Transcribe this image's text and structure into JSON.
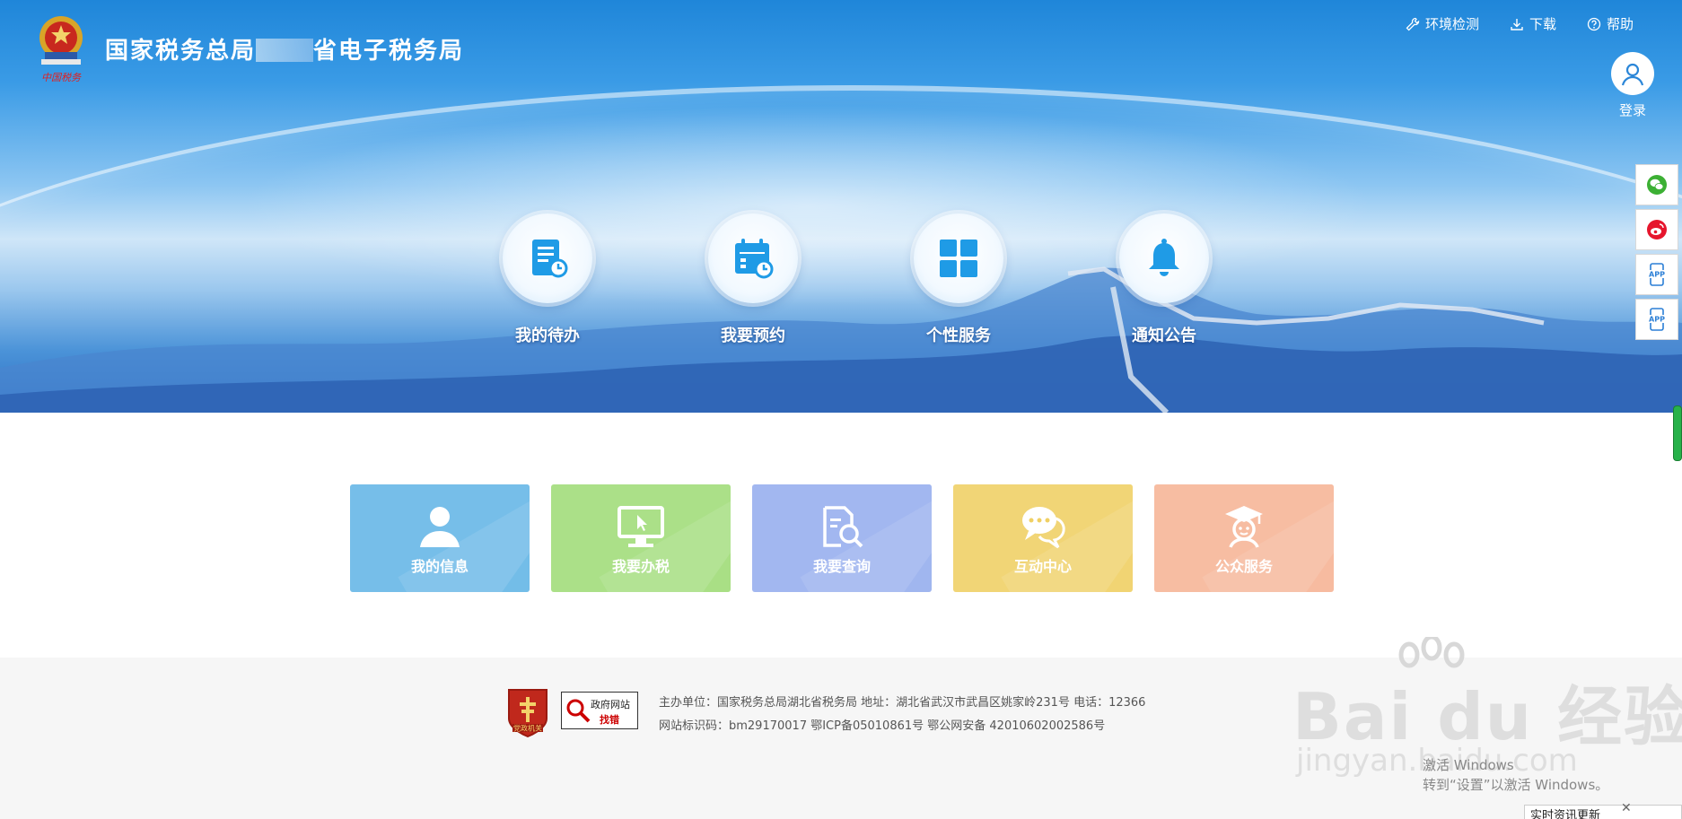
{
  "header": {
    "title_prefix": "国家税务总局",
    "title_suffix": "省电子税务局",
    "logo_caption": "中国税务",
    "links": [
      {
        "label": "环境检测",
        "icon": "wrench-icon"
      },
      {
        "label": "下载",
        "icon": "download-icon"
      },
      {
        "label": "帮助",
        "icon": "help-icon"
      }
    ],
    "login_label": "登录"
  },
  "hero_items": [
    {
      "label": "我的待办",
      "icon": "todo-document-icon"
    },
    {
      "label": "我要预约",
      "icon": "calendar-clock-icon"
    },
    {
      "label": "个性服务",
      "icon": "grid-icon"
    },
    {
      "label": "通知公告",
      "icon": "bell-icon"
    }
  ],
  "side_toolbar": [
    {
      "name": "wechat",
      "icon": "wechat-icon",
      "color": "#3cb034"
    },
    {
      "name": "weibo",
      "icon": "weibo-icon",
      "color": "#e6162d"
    },
    {
      "name": "app1",
      "icon": "app-phone-icon",
      "label": "APP",
      "color": "#2b7fd6"
    },
    {
      "name": "app2",
      "icon": "app-phone-icon",
      "label": "APP",
      "color": "#2b7fd6"
    }
  ],
  "tiles": [
    {
      "label": "我的信息",
      "icon": "user-icon",
      "color": "#64b6e6"
    },
    {
      "label": "我要办税",
      "icon": "monitor-cursor-icon",
      "color": "#a0dc78"
    },
    {
      "label": "我要查询",
      "icon": "document-search-icon",
      "color": "#96aeee"
    },
    {
      "label": "互动中心",
      "icon": "chat-bubbles-icon",
      "color": "#f0d064"
    },
    {
      "label": "公众服务",
      "icon": "graduate-icon",
      "color": "#f6b496"
    }
  ],
  "footer": {
    "badge1_label": "党政机关",
    "badge2_top": "政府网站",
    "badge2_bottom": "找错",
    "line1": "主办单位：国家税务总局湖北省税务局   地址：湖北省武汉市武昌区姚家岭231号  电话：12366",
    "line2": "网站标识码：bm29170017   鄂ICP备05010861号  鄂公网安备 42010602002586号"
  },
  "watermark": {
    "brand": "Bai du 经验",
    "url": "jingyan.baidu.com"
  },
  "os_overlay": {
    "activate_line1": "激活 Windows",
    "activate_line2": "转到“设置”以激活 Windows。",
    "notification": "实时资讯更新"
  }
}
